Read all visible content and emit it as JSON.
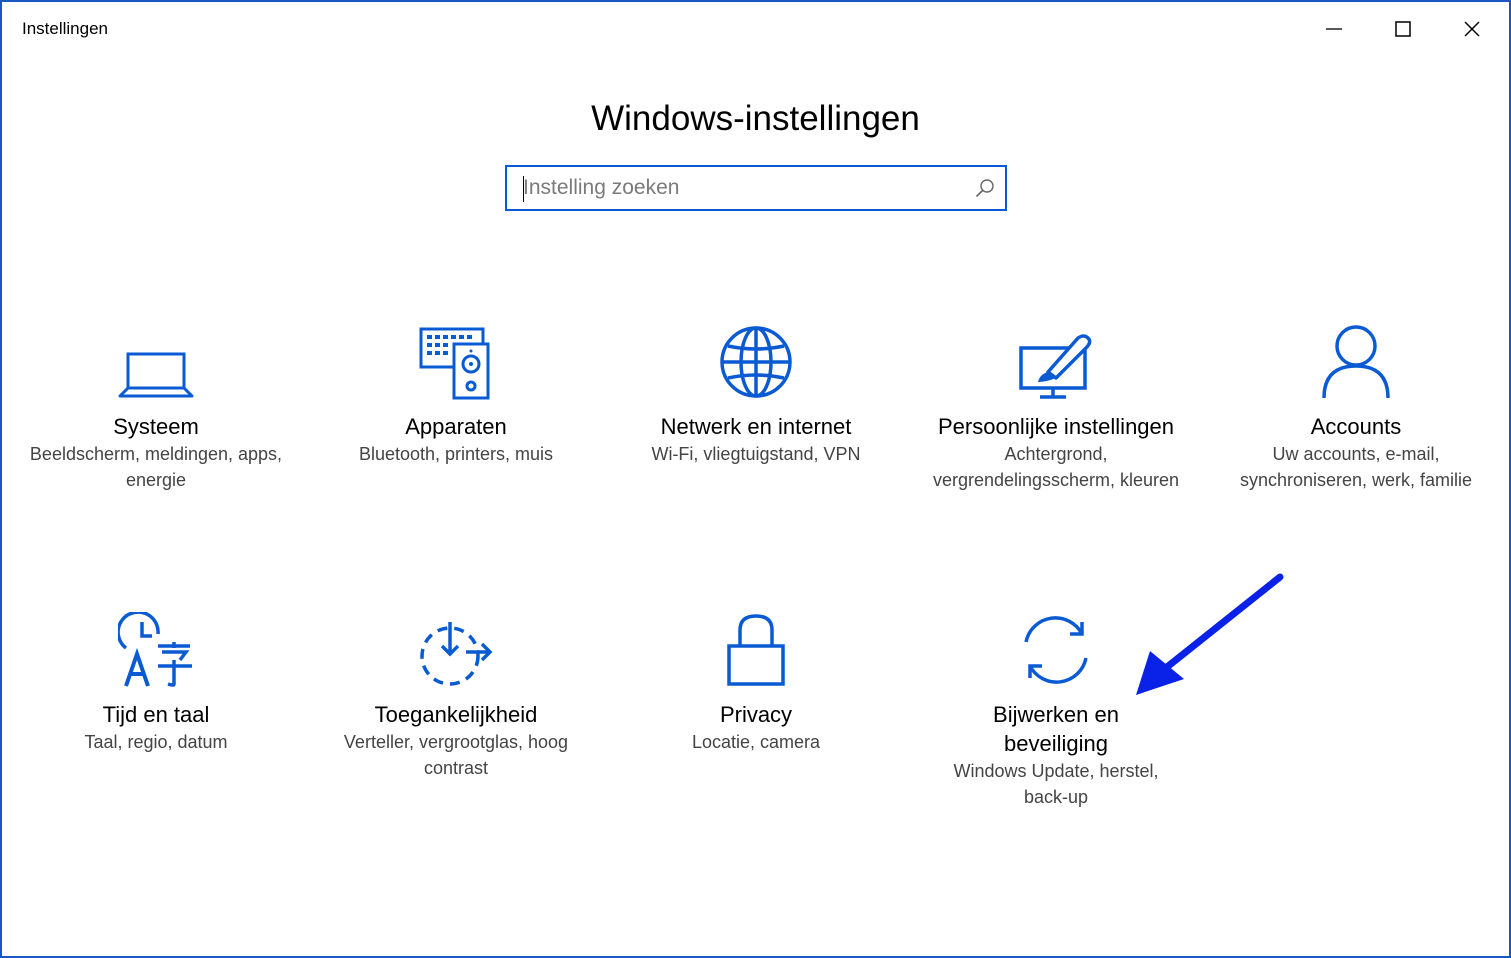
{
  "window": {
    "title": "Instellingen",
    "accent": "#0a5bd3"
  },
  "page": {
    "title": "Windows-instellingen"
  },
  "search": {
    "placeholder": "Instelling zoeken",
    "value": ""
  },
  "tiles": [
    {
      "label": "Systeem",
      "desc": "Beeldscherm, meldingen, apps, energie",
      "icon": "laptop-icon"
    },
    {
      "label": "Apparaten",
      "desc": "Bluetooth, printers, muis",
      "icon": "devices-icon"
    },
    {
      "label": "Netwerk en internet",
      "desc": "Wi-Fi, vliegtuigstand, VPN",
      "icon": "globe-icon"
    },
    {
      "label": "Persoonlijke instellingen",
      "desc": "Achtergrond, vergrendelingsscherm, kleuren",
      "icon": "personalization-icon"
    },
    {
      "label": "Accounts",
      "desc": "Uw accounts, e-mail, synchroniseren, werk, familie",
      "icon": "person-icon"
    },
    {
      "label": "Tijd en taal",
      "desc": "Taal, regio, datum",
      "icon": "time-language-icon"
    },
    {
      "label": "Toegankelijkheid",
      "desc": "Verteller, vergrootglas, hoog contrast",
      "icon": "ease-of-access-icon"
    },
    {
      "label": "Privacy",
      "desc": "Locatie, camera",
      "icon": "lock-icon"
    },
    {
      "label": "Bijwerken en beveiliging",
      "desc": "Windows Update, herstel, back-up",
      "icon": "sync-icon"
    }
  ],
  "annotation": {
    "arrow_color": "#0a22e8"
  }
}
